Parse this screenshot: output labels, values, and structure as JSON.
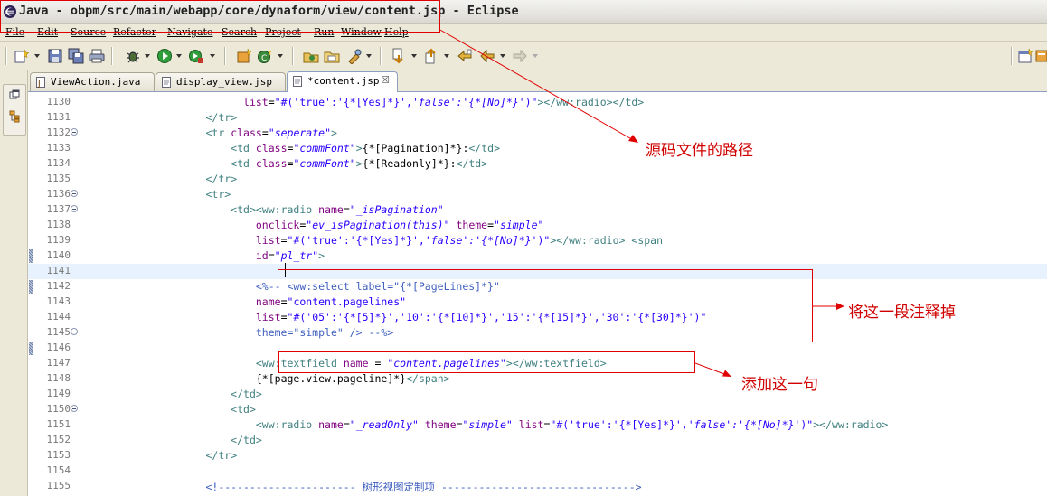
{
  "window": {
    "title": "Java - obpm/src/main/webapp/core/dynaform/view/content.jsp - Eclipse"
  },
  "menu": [
    "File",
    "Edit",
    "Source",
    "Refactor",
    "Navigate",
    "Search",
    "Project",
    "Run",
    "Window",
    "Help"
  ],
  "toolbar": {
    "icons": [
      "new-wizard-icon",
      "save-icon",
      "save-all-icon",
      "print-icon",
      "debug-icon",
      "run-icon",
      "external-tools-icon",
      "new-java-project-icon",
      "new-package-icon",
      "new-class-icon",
      "open-type-icon",
      "open-task-icon",
      "search-icon",
      "next-annotation-icon",
      "previous-annotation-icon",
      "last-edit-location-icon",
      "back-icon",
      "forward-icon",
      "open-perspective-icon"
    ]
  },
  "tabs": [
    {
      "label": "ViewAction.java",
      "active": false
    },
    {
      "label": "display_view.jsp",
      "active": false
    },
    {
      "label": "*content.jsp",
      "active": true
    }
  ],
  "editor": {
    "lines": [
      {
        "num": "1130",
        "text": "                          list=\"#('true':'{*[Yes]*}','false':'{*[No]*}')\"></ww:radio></td>"
      },
      {
        "num": "1131",
        "text": "                    </tr>"
      },
      {
        "num": "1132",
        "text": "                    <tr class=\"seperate\">"
      },
      {
        "num": "1133",
        "text": "                        <td class=\"commFont\">{*[Pagination]*}:</td>"
      },
      {
        "num": "1134",
        "text": "                        <td class=\"commFont\">{*[Readonly]*}:</td>"
      },
      {
        "num": "1135",
        "text": "                    </tr>"
      },
      {
        "num": "1136",
        "text": "                    <tr>"
      },
      {
        "num": "1137",
        "text": "                        <td><ww:radio name=\"_isPagination\""
      },
      {
        "num": "1138",
        "text": "                            onclick=\"ev_isPagination(this)\" theme=\"simple\""
      },
      {
        "num": "1139",
        "text": "                            list=\"#('true':'{*[Yes]*}','false':'{*[No]*}')\"></ww:radio> <span"
      },
      {
        "num": "1140",
        "text": "                            id=\"pl_tr\">"
      },
      {
        "num": "1141",
        "text": ""
      },
      {
        "num": "1142",
        "text": "                            <%-- <ww:select label=\"{*[PageLines]*}\""
      },
      {
        "num": "1143",
        "text": "                            name=\"content.pagelines\""
      },
      {
        "num": "1144",
        "text": "                            list=\"#('05':'{*[5]*}','10':'{*[10]*}','15':'{*[15]*}','30':'{*[30]*}')\""
      },
      {
        "num": "1145",
        "text": "                            theme=\"simple\" /> --%>"
      },
      {
        "num": "1146",
        "text": ""
      },
      {
        "num": "1147",
        "text": "                            <ww:textfield name = \"content.pagelines\"></ww:textfield>"
      },
      {
        "num": "1148",
        "text": "                            {*[page.view.pageline]*}</span>"
      },
      {
        "num": "1149",
        "text": "                        </td>"
      },
      {
        "num": "1150",
        "text": "                        <td>"
      },
      {
        "num": "1151",
        "text": "                            <ww:radio name=\"_readOnly\" theme=\"simple\" list=\"#('true':'{*[Yes]*}','false':'{*[No]*}')\"></ww:radio>"
      },
      {
        "num": "1152",
        "text": "                        </td>"
      },
      {
        "num": "1153",
        "text": "                    </tr>"
      },
      {
        "num": "1154",
        "text": ""
      },
      {
        "num": "1155",
        "text": "                    <!---------------------- 树形视图定制项 ------------------------------->"
      }
    ]
  },
  "annotations": {
    "path_note": "源码文件的路径",
    "comment_note": "将这一段注释掉",
    "add_note": "添加这一句"
  },
  "colors": {
    "annotation_red": "#d00000",
    "tag": "#3f7f7f",
    "attribute": "#7f007f",
    "string": "#2a00ff",
    "jsp_comment": "#3f5fbf",
    "current_line": "#e8f2fe"
  }
}
